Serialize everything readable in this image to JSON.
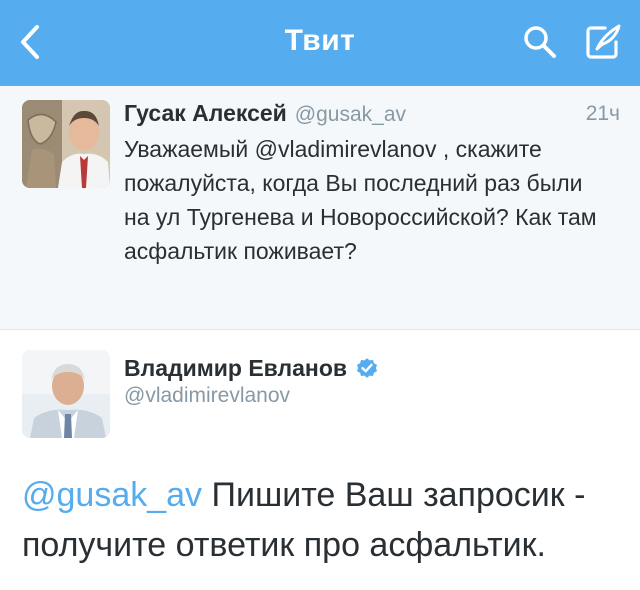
{
  "navbar": {
    "title": "Твит",
    "back_icon": "chevron-left-icon",
    "search_icon": "search-icon",
    "compose_icon": "compose-tweet-icon",
    "background_color": "#55acee"
  },
  "parent_tweet": {
    "author_name": "Гусак Алексей",
    "author_handle": "@gusak_av",
    "timestamp": "21ч",
    "text": "Уважаемый @vladimirevlanov , скажите пожалуйста, когда Вы последний раз были на ул Тургенева и Новороссийской? Как там асфальтик поживает?"
  },
  "reply_tweet": {
    "author_name": "Владимир Евланов",
    "author_handle": "@vladimirevlanov",
    "verified": true,
    "mention": "@gusak_av",
    "text": " Пишите Ваш запросик - получите ответик про асфальтик."
  },
  "colors": {
    "accent": "#55acee",
    "text": "#292f33",
    "muted": "#8899a6",
    "parent_background": "#f5f8fa"
  }
}
